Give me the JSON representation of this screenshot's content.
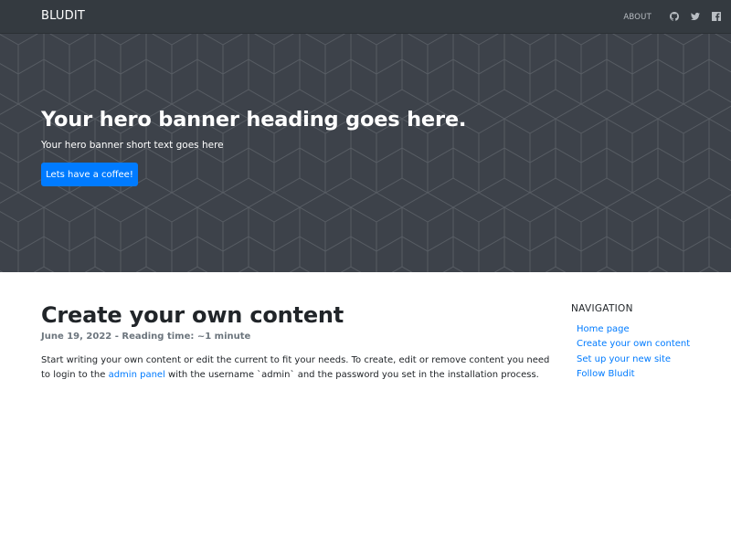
{
  "navbar": {
    "brand": "BLUDIT",
    "links": [
      {
        "label": "ABOUT"
      }
    ],
    "icons": [
      "github-icon",
      "twitter-icon",
      "facebook-icon"
    ]
  },
  "hero": {
    "heading": "Your hero banner heading goes here.",
    "text": "Your hero banner short text goes here",
    "button_label": "Lets have a coffee!"
  },
  "post": {
    "title": "Create your own content",
    "meta": "June 19, 2022 - Reading time: ~1 minute",
    "body_before_link": "Start writing your own content or edit the current to fit your needs. To create, edit or remove content you need to login to the ",
    "link_text": "admin panel",
    "body_after_link": " with the username `admin` and the password you set in the installation process."
  },
  "sidebar": {
    "title": "NAVIGATION",
    "items": [
      {
        "label": "Home page"
      },
      {
        "label": "Create your own content"
      },
      {
        "label": "Set up your new site"
      },
      {
        "label": "Follow Bludit"
      }
    ]
  },
  "colors": {
    "navbar_bg": "#343a40",
    "hero_bg": "#3d424a",
    "accent": "#007bff",
    "muted": "#6c757d"
  }
}
